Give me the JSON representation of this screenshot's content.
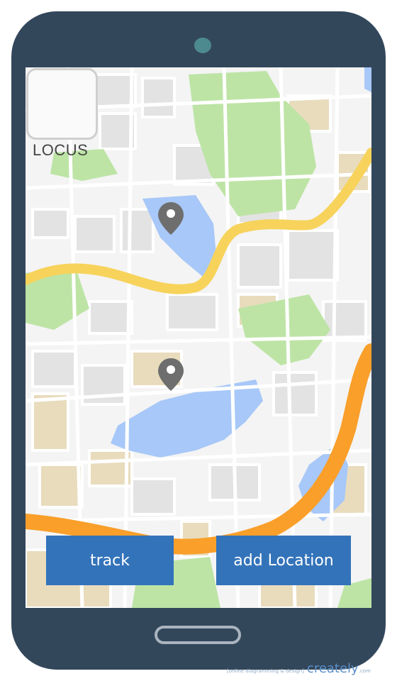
{
  "app": {
    "logo_text": "LOCUS"
  },
  "actions": {
    "track_label": "track",
    "add_location_label": "add Location"
  },
  "map": {
    "pins": [
      {
        "name": "pin-upper",
        "icon": "map-pin-icon"
      },
      {
        "name": "pin-lower",
        "icon": "map-pin-icon"
      }
    ]
  },
  "watermark": {
    "tagline": "[online diagramming & design]",
    "brand": "creately",
    "tld": ".com"
  },
  "colors": {
    "phone_body": "#33475b",
    "button": "#3373ba",
    "road_yellow": "#f7d35c",
    "road_orange": "#f99f2a",
    "water": "#a7c8f8",
    "park": "#bde4a5",
    "block_tan": "#e8dcbd"
  }
}
